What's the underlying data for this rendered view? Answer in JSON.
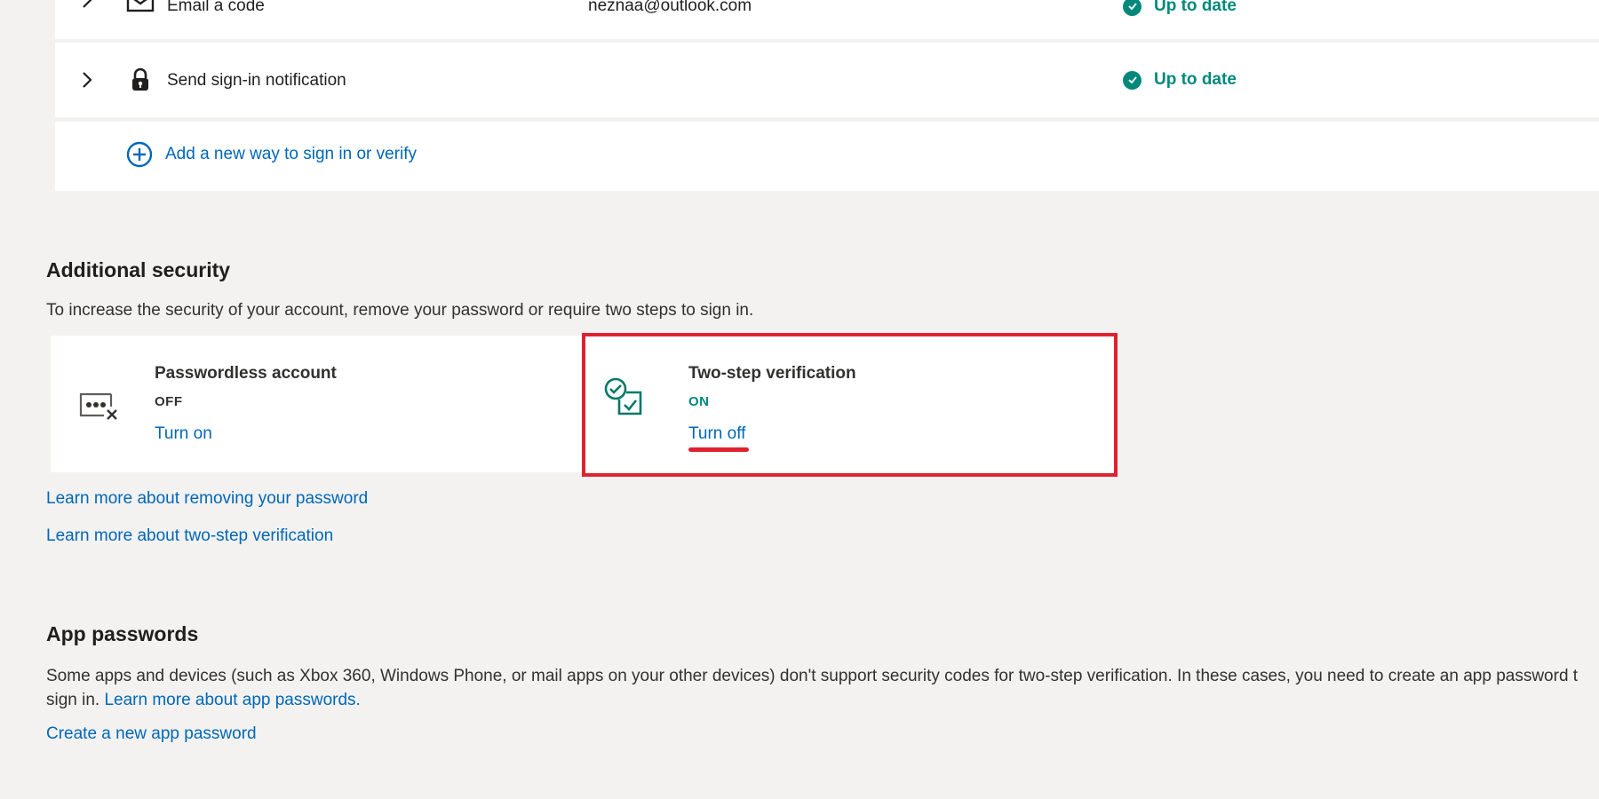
{
  "methods": {
    "email": {
      "label": "Email a code",
      "value": "neznaa@outlook.com",
      "status": "Up to date"
    },
    "notify": {
      "label": "Send sign-in notification",
      "status": "Up to date"
    },
    "add_label": "Add a new way to sign in or verify"
  },
  "additional_security": {
    "title": "Additional security",
    "description": "To increase the security of your account, remove your password or require two steps to sign in.",
    "passwordless": {
      "title": "Passwordless account",
      "state": "OFF",
      "action": "Turn on"
    },
    "two_step": {
      "title": "Two-step verification",
      "state": "ON",
      "action": "Turn off"
    },
    "learn_remove_password": "Learn more about removing your password",
    "learn_two_step": "Learn more about two-step verification"
  },
  "app_passwords": {
    "title": "App passwords",
    "description_line1": "Some apps and devices (such as Xbox 360, Windows Phone, or mail apps on your other devices) don't support security codes for two-step verification. In these cases, you need to create an app password t",
    "description_line2_prefix": "sign in.",
    "learn_link": "Learn more about app passwords.",
    "create_link": "Create a new app password"
  },
  "colors": {
    "accent": "#0067b8",
    "success": "#00897b",
    "highlight": "#e02230"
  }
}
